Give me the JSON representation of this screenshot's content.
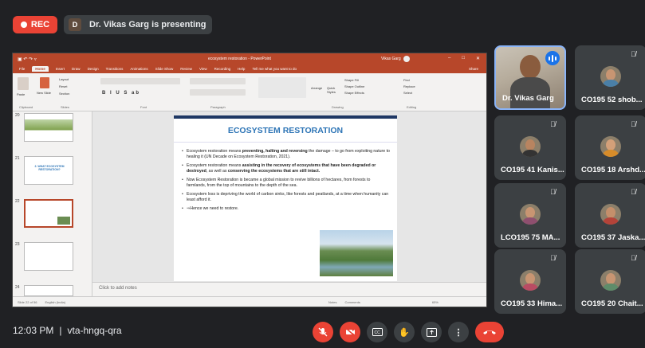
{
  "topbar": {
    "rec_label": "REC",
    "presenter_initial": "D",
    "presenter_text": "Dr. Vikas Garg is presenting"
  },
  "ppt": {
    "window_title": "ecosystem restoration - PowerPoint",
    "user_name": "Vikas Garg",
    "tabs": [
      "File",
      "Home",
      "Insert",
      "Draw",
      "Design",
      "Transitions",
      "Animations",
      "Slide Show",
      "Review",
      "View",
      "Recording",
      "Help",
      "Tell me what you want to do",
      "Share"
    ],
    "ribbon_groups": [
      "Clipboard",
      "Slides",
      "Font",
      "Paragraph",
      "Drawing",
      "Editing"
    ],
    "ribbon_items": {
      "paste": "Paste",
      "new_slide": "New Slide",
      "layout": "Layout",
      "reset": "Reset",
      "section": "Section",
      "arrange": "Arrange",
      "quick_styles": "Quick Styles",
      "shape_fill": "Shape Fill",
      "shape_outline": "Shape Outline",
      "shape_effects": "Shape Effects",
      "find": "Find",
      "replace": "Replace",
      "select": "Select"
    },
    "thumb_numbers": [
      "20",
      "21",
      "22",
      "23",
      "24"
    ],
    "thumb21_text": "2. WHAT ECOSYSTEM RESTORATION?",
    "slide": {
      "heading": "ECOSYSTEM RESTORATION",
      "bullet1_pre": "Ecosystem restoration means ",
      "bullet1_bold": "preventing, halting and reversing",
      "bullet1_post": " the damage – to go from exploiting nature to healing it (UN Decade on Ecosystem Restoration, 2021).",
      "bullet2_pre": "Ecosystem restoration means ",
      "bullet2_bold": "assisting in the recovery of ecosystems that have been degraded or destroyed",
      "bullet2_mid": ", as well as ",
      "bullet2_bold2": "conserving the ecosystems that are still intact.",
      "bullet3": "Now Ecosystem Restoration is became a global mission to revive billions of hectares, from forests to farmlands, from the top of mountains to the depth of the sea.",
      "bullet4": "Ecosystem loss is depriving the world of carbon sinks, like forests and peatlands, at a time when humanity can least afford it.",
      "bullet5": "⇒Hence we need to restore."
    },
    "notes_placeholder": "Click to add notes",
    "status_slide": "Slide 22 of 56",
    "status_lang": "English (India)",
    "status_notes": "Notes",
    "status_comments": "Comments",
    "zoom": "65%"
  },
  "participants": [
    {
      "name": "Dr. Vikas Garg",
      "video": true,
      "speaking": true,
      "muted": false
    },
    {
      "name": "CO195 52 shob...",
      "video": false,
      "muted": true,
      "shirt": "#4a7fa7"
    },
    {
      "name": "CO195 41 Kanis...",
      "video": false,
      "muted": true,
      "shirt": "#333333"
    },
    {
      "name": "CO195 18 Arshd...",
      "video": false,
      "muted": true,
      "shirt": "#d78c2a"
    },
    {
      "name": "LCO195 75 MA...",
      "video": false,
      "muted": true,
      "shirt": "#8e4f6f"
    },
    {
      "name": "CO195 37 Jaska...",
      "video": false,
      "muted": true,
      "shirt": "#b44339"
    },
    {
      "name": "CO195 33 Hima...",
      "video": false,
      "muted": true,
      "shirt": "#b94c63"
    },
    {
      "name": "CO195 20 Chait...",
      "video": false,
      "muted": true,
      "shirt": "#5e8c6a"
    }
  ],
  "bottombar": {
    "time": "12:03 PM",
    "separator": "|",
    "meeting_code": "vta-hngq-qra",
    "controls": [
      "mic-off",
      "camera-off",
      "captions",
      "raise-hand",
      "present",
      "more",
      "end-call"
    ]
  },
  "colors": {
    "background": "#202124",
    "tile": "#3c4043",
    "rec": "#ea4335",
    "ppt_brand": "#b7472a",
    "slide_heading": "#2e75b6",
    "active_speaker": "#8ab4f8"
  }
}
